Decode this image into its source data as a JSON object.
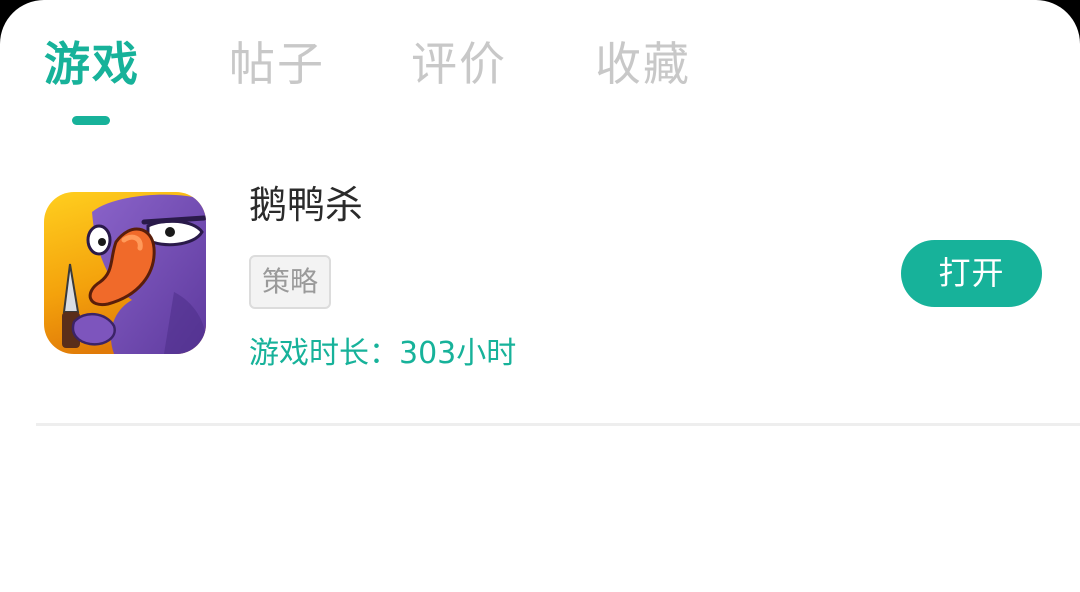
{
  "tabs": [
    {
      "label": "游戏",
      "active": true
    },
    {
      "label": "帖子",
      "active": false
    },
    {
      "label": "评价",
      "active": false
    },
    {
      "label": "收藏",
      "active": false
    }
  ],
  "game": {
    "title": "鹅鸭杀",
    "tag": "策略",
    "play_time": "游戏时长：303小时",
    "open_label": "打开",
    "icon": "goose-duck-game-icon"
  },
  "colors": {
    "accent": "#17b29a",
    "tab_inactive": "#c8c8c8",
    "title": "#2b2b2b",
    "tag_text": "#9a9a9a",
    "divider": "#eeeeee"
  }
}
